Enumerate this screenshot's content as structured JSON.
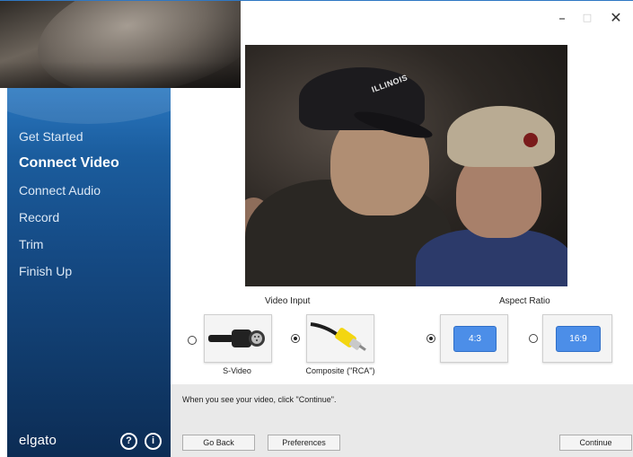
{
  "window": {
    "controls": {
      "minimize": "–",
      "maximize": "□",
      "close": "✕"
    }
  },
  "sidebar": {
    "items": [
      {
        "label": "Get Started",
        "active": false
      },
      {
        "label": "Connect Video",
        "active": true
      },
      {
        "label": "Connect Audio",
        "active": false
      },
      {
        "label": "Record",
        "active": false
      },
      {
        "label": "Trim",
        "active": false
      },
      {
        "label": "Finish Up",
        "active": false
      }
    ],
    "brand": "elgato",
    "help_icon": "?",
    "info_icon": "i"
  },
  "preview": {
    "cap_text": "ILLINOIS"
  },
  "video_input": {
    "label": "Video Input",
    "options": [
      {
        "caption": "S-Video",
        "selected": false,
        "icon": "s-video-connector-icon"
      },
      {
        "caption": "Composite (\"RCA\")",
        "selected": true,
        "icon": "rca-connector-icon"
      }
    ]
  },
  "aspect_ratio": {
    "label": "Aspect Ratio",
    "options": [
      {
        "value": "4:3",
        "selected": true
      },
      {
        "value": "16:9",
        "selected": false
      }
    ]
  },
  "hint": "When you see your video, click \"Continue\".",
  "buttons": {
    "back": "Go Back",
    "preferences": "Preferences",
    "continue": "Continue"
  },
  "colors": {
    "sidebar_top": "#2a77c0",
    "sidebar_bottom": "#0c2c54",
    "chip": "#4c8ee8"
  }
}
